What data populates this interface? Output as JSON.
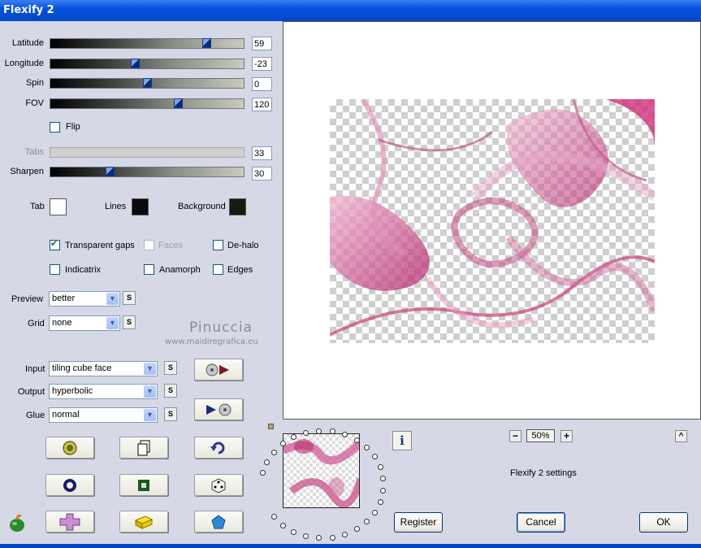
{
  "window": {
    "title": "Flexify 2"
  },
  "sliders": [
    {
      "label": "Latitude",
      "value": "59",
      "pos": 0.82,
      "disabled": false
    },
    {
      "label": "Longitude",
      "value": "-23",
      "pos": 0.44,
      "disabled": false
    },
    {
      "label": "Spin",
      "value": "0",
      "pos": 0.5,
      "disabled": false
    },
    {
      "label": "FOV",
      "value": "120",
      "pos": 0.66,
      "disabled": false
    },
    {
      "label": "Tabs",
      "value": "33",
      "pos": null,
      "disabled": true
    },
    {
      "label": "Sharpen",
      "value": "30",
      "pos": 0.31,
      "disabled": false
    }
  ],
  "flip": {
    "label": "Flip",
    "checked": false
  },
  "colors": {
    "tab_label": "Tab",
    "tab_color": "#ffffff",
    "lines_label": "Lines",
    "lines_color": "#0a0a0a",
    "background_label": "Background",
    "background_color": "#161a14"
  },
  "checkboxes": {
    "transparent_gaps": {
      "label": "Transparent gaps",
      "checked": true
    },
    "faces": {
      "label": "Faces",
      "checked": false,
      "disabled": true
    },
    "dehalo": {
      "label": "De-halo",
      "checked": false
    },
    "indicatrix": {
      "label": "Indicatrix",
      "checked": false
    },
    "anamorph": {
      "label": "Anamorph",
      "checked": false
    },
    "edges": {
      "label": "Edges",
      "checked": false
    }
  },
  "selects": {
    "preview": {
      "label": "Preview",
      "value": "better"
    },
    "grid": {
      "label": "Grid",
      "value": "none"
    },
    "input": {
      "label": "Input",
      "value": "tiling cube face"
    },
    "output": {
      "label": "Output",
      "value": "hyperbolic"
    },
    "glue": {
      "label": "Glue",
      "value": "normal"
    }
  },
  "s_button_label": "S",
  "watermark": {
    "name": "Pinuccia",
    "url": "www.maidiregrafica.eu"
  },
  "zoom": {
    "minus": "−",
    "value": "50%",
    "plus": "+"
  },
  "collapse_label": "^",
  "info_label": "i",
  "settings_text": "Flexify 2 settings",
  "buttons": {
    "register": "Register",
    "cancel": "Cancel",
    "ok": "OK"
  }
}
